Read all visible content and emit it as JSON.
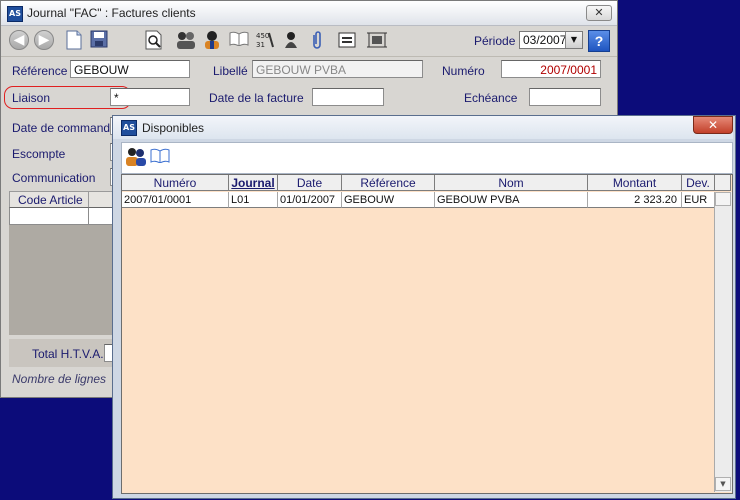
{
  "main_window": {
    "title": "Journal \"FAC\" : Factures clients",
    "close_glyph": "✕",
    "app_icon_text": "AS",
    "toolbar": {
      "icons": [
        "back-icon",
        "forward-icon",
        "new-document-icon",
        "save-icon",
        "search-preview-icon",
        "users-icon",
        "user-icon",
        "book-icon",
        "calendar-icon",
        "person-icon",
        "paperclip-icon",
        "transfer-icon",
        "layout-icon"
      ],
      "periode_label": "Période",
      "periode_value": "03/2007",
      "help_label": "?"
    },
    "row1": {
      "reference_label": "Référence",
      "reference_value": "GEBOUW",
      "libelle_label": "Libellé",
      "libelle_value": "GEBOUW PVBA",
      "numero_label": "Numéro",
      "numero_value": "2007/0001"
    },
    "row2": {
      "liaison_label": "Liaison",
      "liaison_value": "*",
      "date_facture_label": "Date de la facture",
      "date_facture_value": "",
      "echeance_label": "Echéance",
      "echeance_value": ""
    },
    "row3": {
      "date_commande_label": "Date de commande"
    },
    "row4": {
      "escompte_label": "Escompte"
    },
    "row5": {
      "communication_label": "Communication"
    },
    "grid": {
      "code_article_header": "Code Article"
    },
    "footer": {
      "total_label": "Total H.T.V.A.",
      "nombre_lignes_label": "Nombre de lignes"
    }
  },
  "popup": {
    "title": "Disponibles",
    "close_glyph": "✕",
    "app_icon_text": "AS",
    "columns": [
      "Numéro",
      "Journal",
      "Date",
      "Référence",
      "Nom",
      "Montant",
      "Dev."
    ],
    "active_column": "Journal",
    "rows": [
      {
        "numero": "2007/01/0001",
        "journal": "L01",
        "date": "01/01/2007",
        "reference": "GEBOUW",
        "nom": "GEBOUW PVBA",
        "montant": "2 323.20",
        "dev": "EUR"
      }
    ]
  },
  "colors": {
    "desktop": "#0c0c7a",
    "popup_table_bg": "#fde1c7",
    "numero_red": "#b00000",
    "liaison_outline": "#e02020"
  }
}
